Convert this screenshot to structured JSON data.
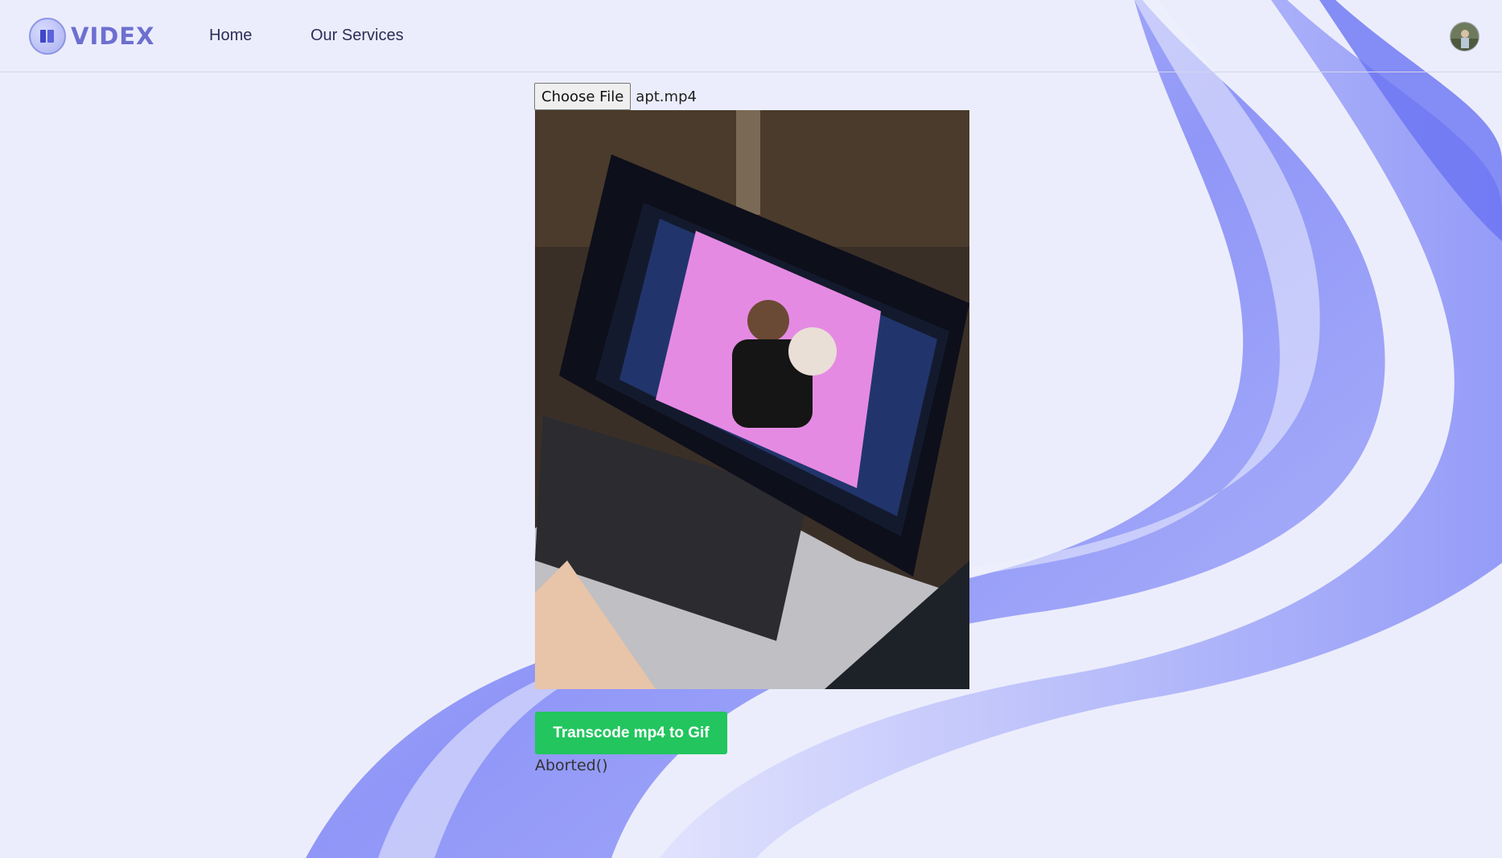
{
  "header": {
    "brand": "VIDEX",
    "nav": [
      {
        "label": "Home"
      },
      {
        "label": "Our Services"
      }
    ]
  },
  "upload": {
    "button_label": "Choose File",
    "file_name": "apt.mp4"
  },
  "actions": {
    "transcode_label": "Transcode mp4 to Gif"
  },
  "status": {
    "text": "Aborted()"
  },
  "colors": {
    "background": "#ecedfc",
    "accent": "#6d6fd0",
    "button": "#22c55e"
  }
}
